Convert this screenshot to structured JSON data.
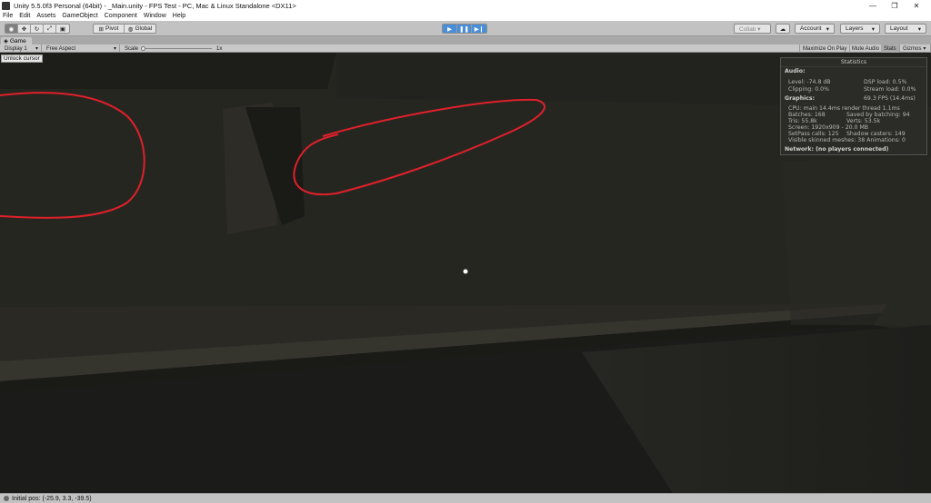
{
  "window": {
    "title": "Unity 5.5.0f3 Personal (64bit) - _Main.unity - FPS Test - PC, Mac & Linux Standalone <DX11>",
    "minimize": "—",
    "restore": "❐",
    "close": "✕"
  },
  "menu": [
    "File",
    "Edit",
    "Assets",
    "GameObject",
    "Component",
    "Window",
    "Help"
  ],
  "toolbar": {
    "pivot": "Pivot",
    "global": "Global",
    "collab": "Collab ▾",
    "account": "Account",
    "layers": "Layers",
    "layout": "Layout"
  },
  "game_view": {
    "tab": "Game",
    "display": "Display 1",
    "aspect": "Free Aspect",
    "scale_label": "Scale",
    "scale_value": "1x",
    "maximize": "Maximize On Play",
    "mute": "Mute Audio",
    "stats": "Stats",
    "gizmos": "Gizmos",
    "unlock": "Unlock cursor"
  },
  "statistics": {
    "title": "Statistics",
    "audio_label": "Audio:",
    "level": "Level: -74.8 dB",
    "dsp": "DSP load: 0.5%",
    "clipping": "Clipping: 0.0%",
    "stream": "Stream load: 0.0%",
    "graphics_label": "Graphics:",
    "fps": "69.3 FPS (14.4ms)",
    "cpu": "CPU: main 14.4ms  render thread 1.1ms",
    "batches": "Batches: 168",
    "saved": "Saved by batching: 94",
    "tris": "Tris: 55.8k",
    "verts": "Verts: 53.5k",
    "screen": "Screen: 1920x909 - 20.0 MB",
    "setpass": "SetPass calls: 125",
    "shadow": "Shadow casters: 149",
    "skinned": "Visible skinned meshes: 38  Animations: 0",
    "network": "Network: (no players connected)"
  },
  "status": {
    "text": "Initial pos: (-25.9, 3.3, -39.5)"
  },
  "colors": {
    "annotation": "#e0202a",
    "play_active": "#4a8ed8"
  }
}
